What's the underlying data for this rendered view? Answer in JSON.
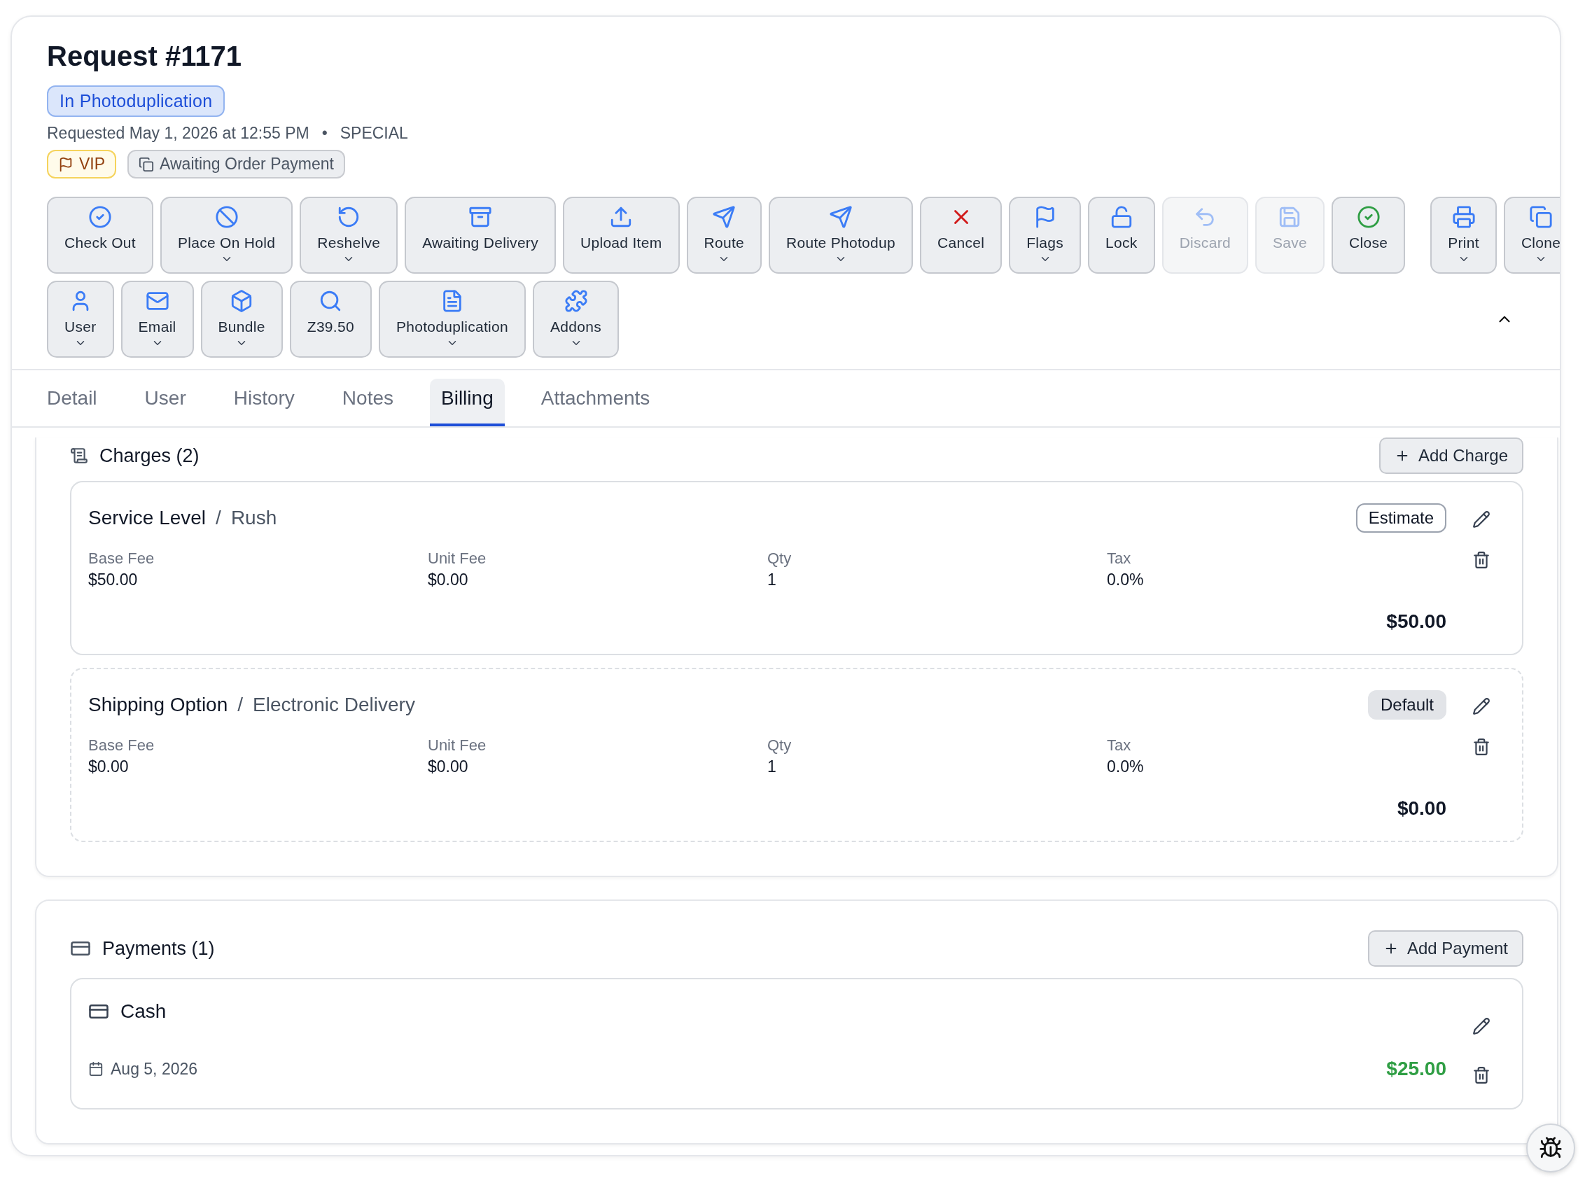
{
  "title": "Request #1171",
  "status": "In Photoduplication",
  "requested": "Requested May 1, 2026 at 12:55 PM",
  "separator": "•",
  "request_type": "SPECIAL",
  "tags": [
    {
      "label": "VIP",
      "kind": "flag"
    },
    {
      "label": "Awaiting Order Payment",
      "kind": "state"
    }
  ],
  "toolbar": {
    "main_actions": [
      {
        "label": "Check Out",
        "dropdown": false,
        "disabled": false
      },
      {
        "label": "Place On Hold",
        "dropdown": true,
        "disabled": false
      },
      {
        "label": "Reshelve",
        "dropdown": true,
        "disabled": false
      },
      {
        "label": "Awaiting Delivery",
        "dropdown": false,
        "disabled": false
      },
      {
        "label": "Upload Item",
        "dropdown": false,
        "disabled": false
      },
      {
        "label": "Route",
        "dropdown": true,
        "disabled": false
      },
      {
        "label": "Route Photodup",
        "dropdown": true,
        "disabled": false
      },
      {
        "label": "Cancel",
        "dropdown": false,
        "disabled": false
      },
      {
        "label": "Flags",
        "dropdown": true,
        "disabled": false
      },
      {
        "label": "Lock",
        "dropdown": false,
        "disabled": false
      },
      {
        "label": "Discard",
        "dropdown": false,
        "disabled": true
      },
      {
        "label": "Save",
        "dropdown": false,
        "disabled": true
      },
      {
        "label": "Close",
        "dropdown": false,
        "disabled": false
      }
    ],
    "more_actions": [
      {
        "label": "User",
        "dropdown": true,
        "disabled": false
      },
      {
        "label": "Email",
        "dropdown": true,
        "disabled": false
      },
      {
        "label": "Bundle",
        "dropdown": true,
        "disabled": false
      },
      {
        "label": "Z39.50",
        "dropdown": false,
        "disabled": false
      },
      {
        "label": "Photoduplication",
        "dropdown": true,
        "disabled": false
      },
      {
        "label": "Addons",
        "dropdown": true,
        "disabled": false
      }
    ],
    "end_group": [
      {
        "label": "Print",
        "dropdown": true,
        "disabled": false
      },
      {
        "label": "Clone",
        "dropdown": true,
        "disabled": false
      }
    ],
    "expanded": true
  },
  "tabs": [
    {
      "label": "Detail",
      "selected": false
    },
    {
      "label": "User",
      "selected": false
    },
    {
      "label": "History",
      "selected": false
    },
    {
      "label": "Notes",
      "selected": false
    },
    {
      "label": "Billing",
      "selected": true
    },
    {
      "label": "Attachments",
      "selected": false
    }
  ],
  "charges": {
    "title": "Charges (2)",
    "add_label": "Add Charge",
    "items": [
      {
        "name": "Service Level",
        "separator": "/",
        "option": "Rush",
        "badge": "Estimate",
        "kind": "estimate",
        "fields": [
          {
            "label": "Base Fee",
            "value": "$50.00"
          },
          {
            "label": "Unit Fee",
            "value": "$0.00"
          },
          {
            "label": "Qty",
            "value": "1"
          },
          {
            "label": "Tax",
            "value": "0.0%"
          }
        ],
        "total": "$50.00"
      },
      {
        "name": "Shipping Option",
        "separator": "/",
        "option": "Electronic Delivery",
        "badge": "Default",
        "kind": "default",
        "fields": [
          {
            "label": "Base Fee",
            "value": "$0.00"
          },
          {
            "label": "Unit Fee",
            "value": "$0.00"
          },
          {
            "label": "Qty",
            "value": "1"
          },
          {
            "label": "Tax",
            "value": "0.0%"
          }
        ],
        "total": "$0.00"
      }
    ]
  },
  "payments": {
    "title": "Payments (1)",
    "add_label": "Add Payment",
    "items": [
      {
        "method": "Cash",
        "date": "Aug 5, 2026",
        "amount": "$25.00"
      }
    ]
  }
}
